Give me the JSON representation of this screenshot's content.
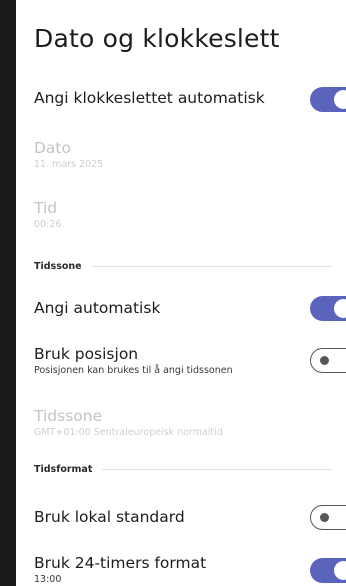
{
  "page": {
    "title": "Dato og klokkeslett"
  },
  "settings": {
    "auto_time": {
      "title": "Angi klokkeslettet automatisk",
      "enabled": true
    },
    "date": {
      "title": "Dato",
      "value": "11. mars 2025"
    },
    "time": {
      "title": "Tid",
      "value": "00:26"
    },
    "timezone_section": {
      "label": "Tidssone"
    },
    "auto_timezone": {
      "title": "Angi automatisk",
      "enabled": true
    },
    "use_location": {
      "title": "Bruk posisjon",
      "subtitle": "Posisjonen kan brukes til å angi tidssonen",
      "enabled": false
    },
    "timezone": {
      "title": "Tidssone",
      "value": "GMT+01:00 Sentraleuropeisk normaltid"
    },
    "format_section": {
      "label": "Tidsformat"
    },
    "locale_default": {
      "title": "Bruk lokal standard",
      "enabled": false
    },
    "use_24h": {
      "title": "Bruk 24-timers format",
      "subtitle": "13:00",
      "enabled": true
    }
  },
  "colors": {
    "accent": "#5a64bd",
    "background_frame": "#1b1b1d",
    "screen": "#ffffff",
    "disabled_text": "#c4c4c8"
  }
}
